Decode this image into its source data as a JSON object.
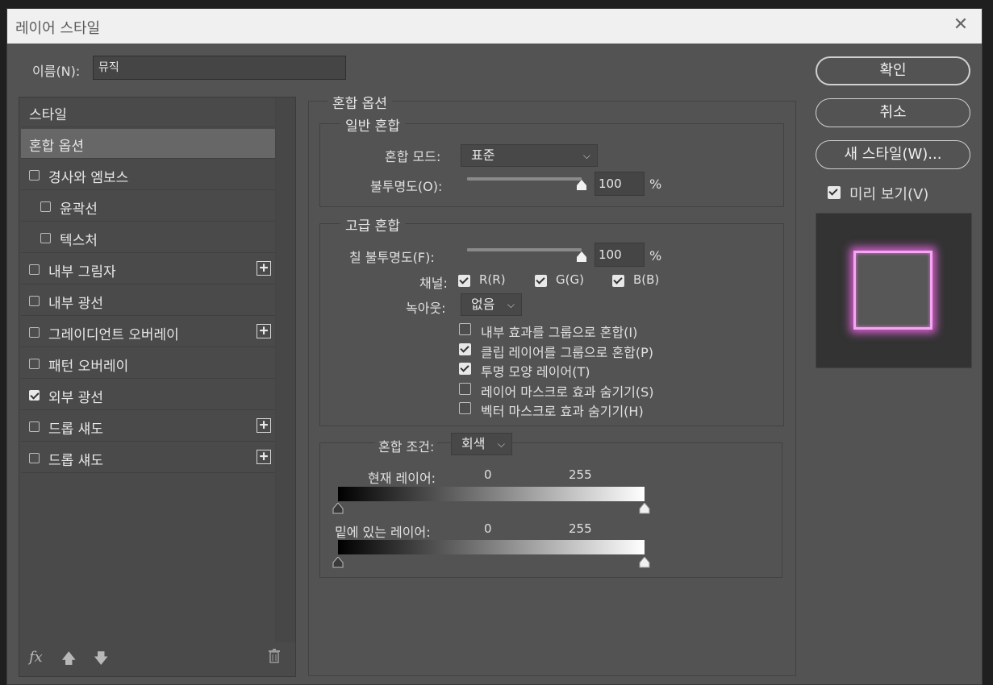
{
  "window": {
    "title": "레이어 스타일",
    "close_glyph": "✕"
  },
  "name_row": {
    "label": "이름(N):",
    "value": "뮤직"
  },
  "style_list": {
    "header": "스타일",
    "items": [
      {
        "label": "혼합 옵션",
        "checkbox": false,
        "selected": true,
        "plus": false
      },
      {
        "label": "경사와 엠보스",
        "checkbox": true,
        "checked": false,
        "plus": false
      },
      {
        "label": "윤곽선",
        "checkbox": true,
        "checked": false,
        "plus": false,
        "indent": true
      },
      {
        "label": "텍스처",
        "checkbox": true,
        "checked": false,
        "plus": false,
        "indent": true
      },
      {
        "label": "내부 그림자",
        "checkbox": true,
        "checked": false,
        "plus": true
      },
      {
        "label": "내부 광선",
        "checkbox": true,
        "checked": false,
        "plus": false
      },
      {
        "label": "그레이디언트 오버레이",
        "checkbox": true,
        "checked": false,
        "plus": true
      },
      {
        "label": "패턴 오버레이",
        "checkbox": true,
        "checked": false,
        "plus": false
      },
      {
        "label": "외부 광선",
        "checkbox": true,
        "checked": true,
        "plus": false
      },
      {
        "label": "드롭 섀도",
        "checkbox": true,
        "checked": false,
        "plus": true
      },
      {
        "label": "드롭 섀도",
        "checkbox": true,
        "checked": false,
        "plus": true
      }
    ],
    "bottom_icons": [
      "fx-icon",
      "arrow-up-icon",
      "arrow-down-icon",
      "trash-icon"
    ],
    "fx_label": "fx"
  },
  "blend_options": {
    "title": "혼합 옵션",
    "general": {
      "title": "일반 혼합",
      "mode_label": "혼합 모드:",
      "mode_value": "표준",
      "opacity_label": "불투명도(O):",
      "opacity_value": "100",
      "opacity_unit": "%",
      "opacity_fraction": 1.0
    },
    "advanced": {
      "title": "고급 혼합",
      "fill_label": "칠 불투명도(F):",
      "fill_value": "100",
      "fill_unit": "%",
      "fill_fraction": 1.0,
      "channels_label": "채널:",
      "channels": [
        {
          "label": "R(R)",
          "checked": true
        },
        {
          "label": "G(G)",
          "checked": true
        },
        {
          "label": "B(B)",
          "checked": true
        }
      ],
      "knockout_label": "녹아웃:",
      "knockout_value": "없음",
      "options": [
        {
          "label": "내부 효과를 그룹으로 혼합(I)",
          "checked": false
        },
        {
          "label": "클립 레이어를 그룹으로 혼합(P)",
          "checked": true
        },
        {
          "label": "투명 모양 레이어(T)",
          "checked": true
        },
        {
          "label": "레이어 마스크로 효과 숨기기(S)",
          "checked": false
        },
        {
          "label": "벡터 마스크로 효과 숨기기(H)",
          "checked": false
        }
      ]
    },
    "blend_if": {
      "label": "혼합 조건:",
      "value": "회색",
      "current_layer_label": "현재 레이어:",
      "current_low": "0",
      "current_high": "255",
      "underlying_layer_label": "밑에 있는 레이어:",
      "underlying_low": "0",
      "underlying_high": "255"
    }
  },
  "buttons": {
    "ok": "확인",
    "cancel": "취소",
    "new_style": "새 스타일(W)..."
  },
  "preview": {
    "label": "미리 보기(V)",
    "checked": true,
    "glow_color": "#e27ae0"
  }
}
